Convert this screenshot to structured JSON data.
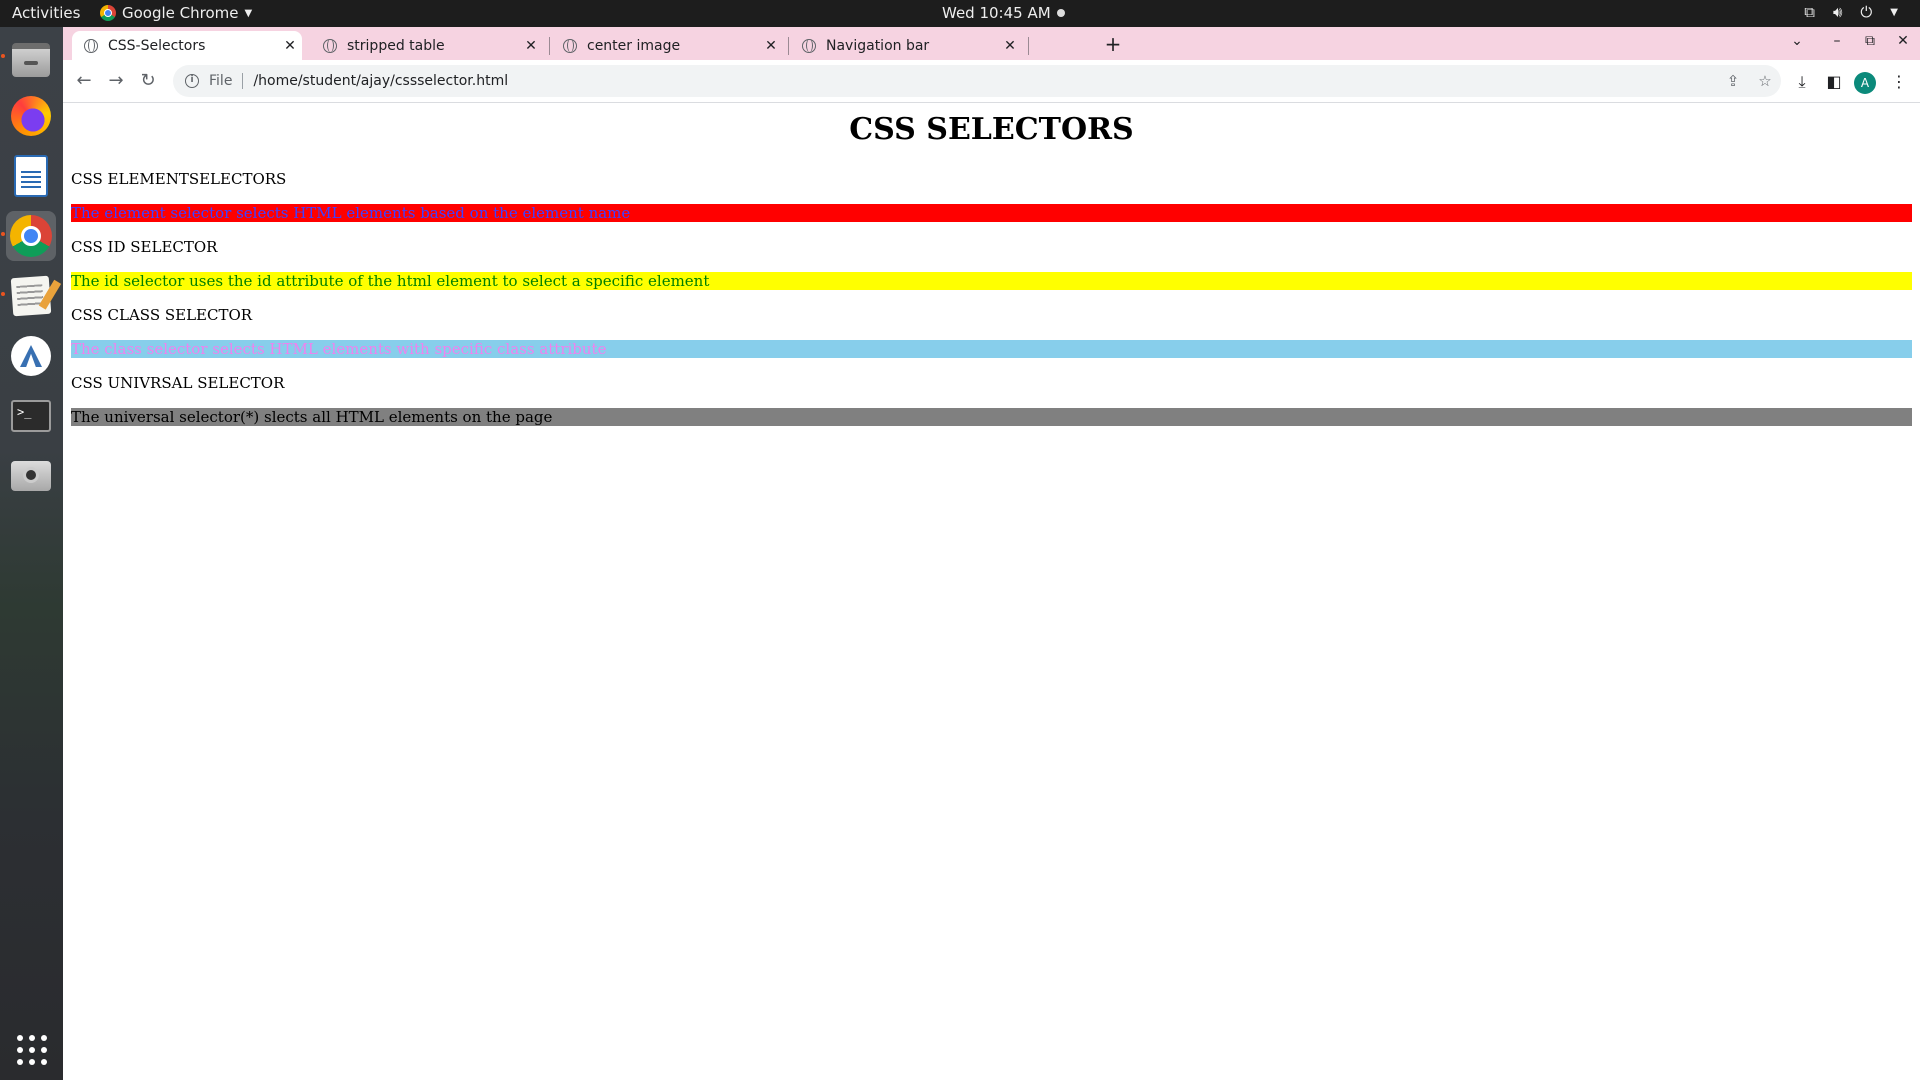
{
  "system_bar": {
    "activities": "Activities",
    "app_name": "Google Chrome",
    "clock": "Wed 10:45 AM"
  },
  "tabs": [
    {
      "title": "CSS-Selectors",
      "active": true
    },
    {
      "title": "stripped table",
      "active": false
    },
    {
      "title": "center image",
      "active": false
    },
    {
      "title": "Navigation bar",
      "active": false
    }
  ],
  "address_bar": {
    "scheme": "File",
    "url": "/home/student/ajay/cssselector.html"
  },
  "profile": {
    "initial": "A",
    "color": "#0b8a7b"
  },
  "dock_icons": [
    "files-icon",
    "firefox-icon",
    "writer-icon",
    "chrome-icon",
    "text-editor-icon",
    "android-studio-icon",
    "terminal-icon",
    "camera-icon",
    "show-apps-icon"
  ],
  "page": {
    "heading": "CSS SELECTORS",
    "sections": [
      {
        "label": "CSS ELEMENTSELECTORS",
        "text": "The element selector selects HTML elements based on the element name",
        "bg": "#ff0000",
        "fg": "#4040ff"
      },
      {
        "label": "CSS ID SELECTOR",
        "text": "The id selector uses the id attribute of the html element to select a specific element",
        "bg": "#ffff00",
        "fg": "#008000"
      },
      {
        "label": "CSS CLASS SELECTOR",
        "text": "The class selector selects HTML elements with specific class attribute",
        "bg": "#87ceeb",
        "fg": "#ee82ee"
      },
      {
        "label": "CSS UNIVRSAL SELECTOR",
        "text": "The universal selector(*) slects all HTML elements on the page",
        "bg": "#808080",
        "fg": "#000000"
      }
    ]
  }
}
